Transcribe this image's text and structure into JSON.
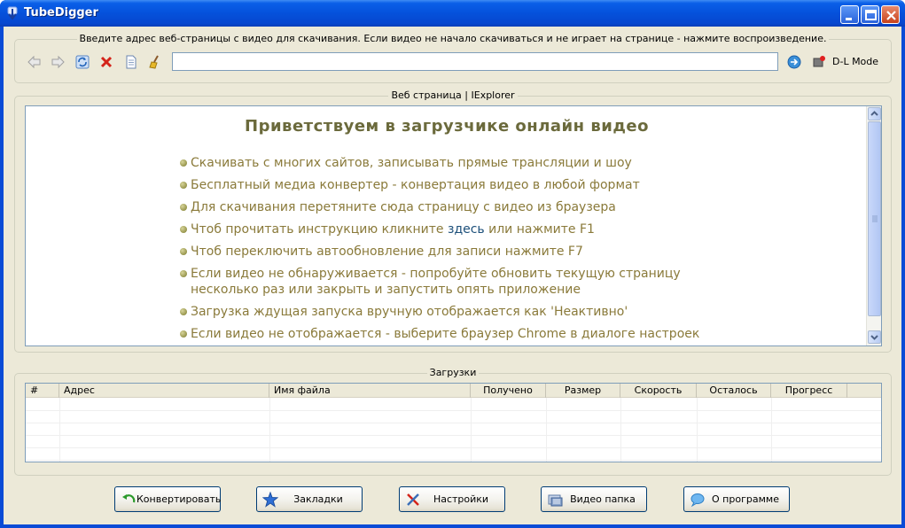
{
  "window": {
    "title": "TubeDigger"
  },
  "address_group": {
    "legend": "Введите адрес веб-страницы с видео для скачивания. Если видео не начало скачиваться и не играет на странице - нажмите воспроизведение.",
    "url_value": "",
    "dl_mode_label": "D-L Mode",
    "icons": [
      "back-arrow-icon",
      "forward-arrow-icon",
      "refresh-icon",
      "stop-icon",
      "page-icon",
      "clear-broom-icon",
      "go-icon",
      "record-icon"
    ]
  },
  "browser_group": {
    "legend": "Веб страница | IExplorer",
    "heading": "Приветствуем в загрузчике онлайн видео",
    "bullets": [
      {
        "text": "Скачивать с многих сайтов, записывать прямые трансляции и шоу"
      },
      {
        "text": "Бесплатный медиа конвертер - конвертация видео в любой формат"
      },
      {
        "text": "Для скачивания перетяните сюда страницу с видео из браузера"
      },
      {
        "before": "Чтоб прочитать инструкцию кликните ",
        "link": "здесь",
        "after": " или нажмите F1"
      },
      {
        "text": "Чтоб переключить автообновление для записи нажмите F7"
      },
      {
        "text": "Если видео не обнаруживается - попробуйте обновить текущую страницу несколько раз или закрыть и запустить опять приложение"
      },
      {
        "text": "Загрузка ждущая запуска вручную отображается как 'Неактивно'"
      },
      {
        "text": "Если видео не отображается - выберите браузер Chrome в диалоге настроек"
      }
    ]
  },
  "downloads_group": {
    "legend": "Загрузки",
    "columns": [
      "#",
      "Адрес",
      "Имя файла",
      "Получено",
      "Размер",
      "Скорость",
      "Осталось",
      "Прогресс"
    ],
    "rows": []
  },
  "buttons": {
    "convert": "Конвертировать",
    "bookmarks": "Закладки",
    "settings": "Настройки",
    "video_folder": "Видео папка",
    "about": "О программе"
  },
  "colors": {
    "title_bar": "#0551db",
    "heading": "#6b6a3c",
    "bullet_text": "#8a7a3a",
    "link": "#1c4f7a",
    "face": "#ece9d8"
  }
}
